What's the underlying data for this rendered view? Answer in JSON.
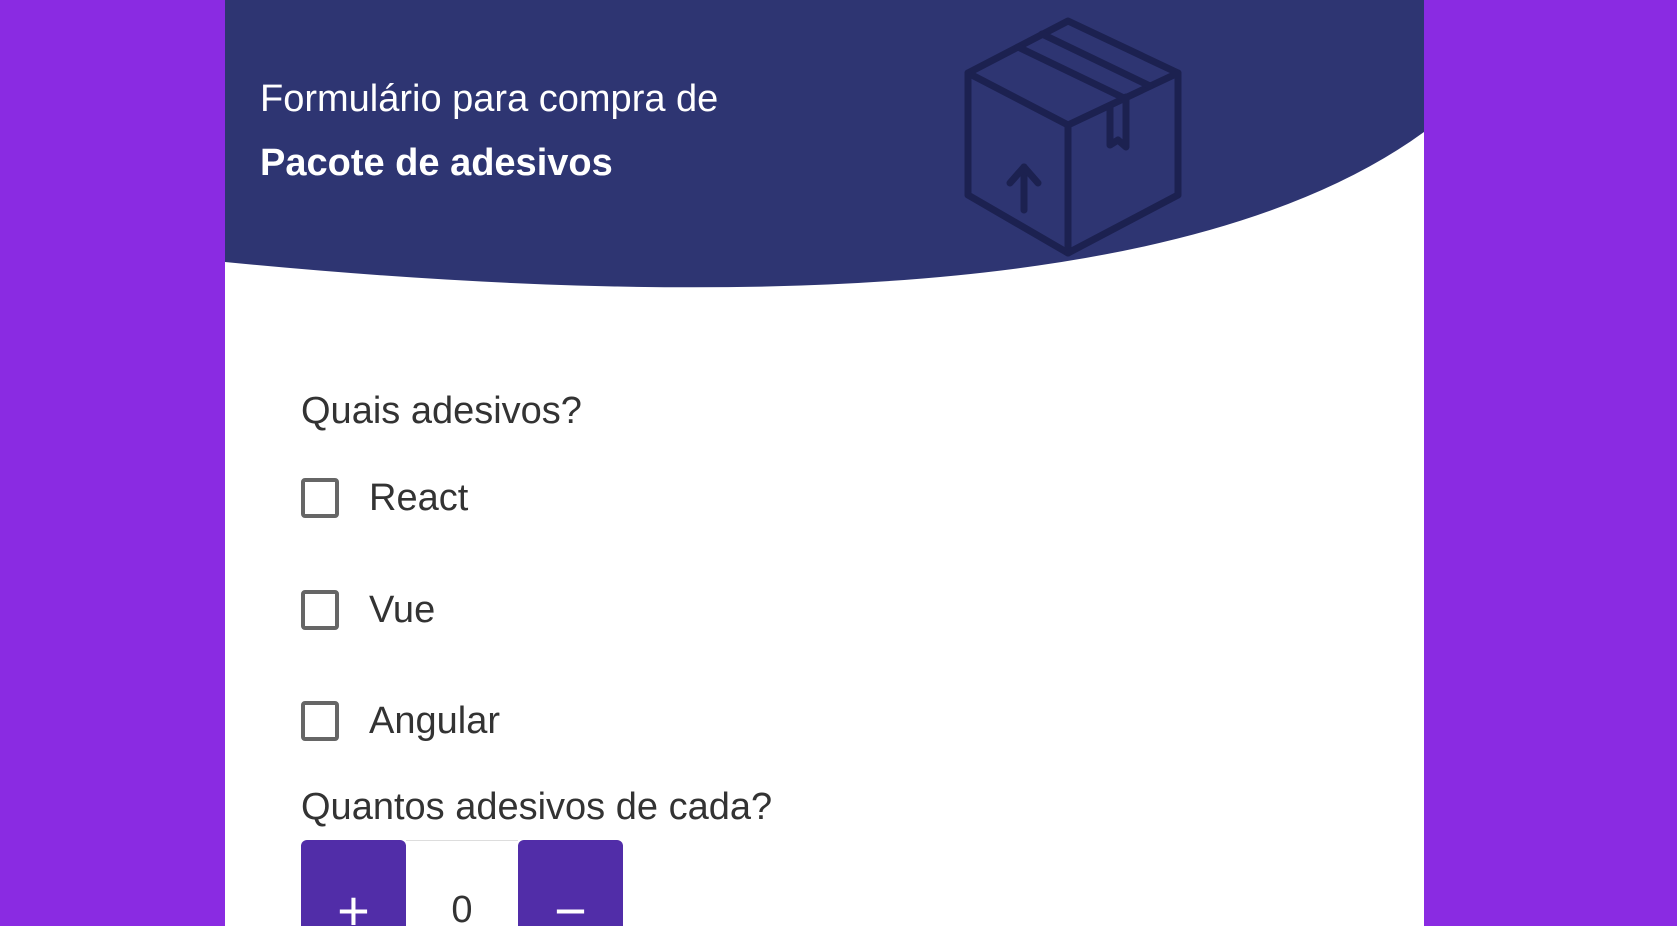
{
  "colors": {
    "page_background": "#8a2be2",
    "header_background": "#2e3572",
    "accent": "#512da8",
    "card_background": "#ffffff"
  },
  "header": {
    "title_line1": "Formulário para compra de",
    "title_line2": "Pacote de adesivos",
    "icon": "package-box-icon"
  },
  "form": {
    "stickers_question": "Quais adesivos?",
    "options": [
      {
        "label": "React",
        "checked": false
      },
      {
        "label": "Vue",
        "checked": false
      },
      {
        "label": "Angular",
        "checked": false
      }
    ],
    "quantity_question": "Quantos adesivos de cada?",
    "stepper": {
      "increment_label": "+",
      "value": "0",
      "decrement_label": "−"
    }
  }
}
